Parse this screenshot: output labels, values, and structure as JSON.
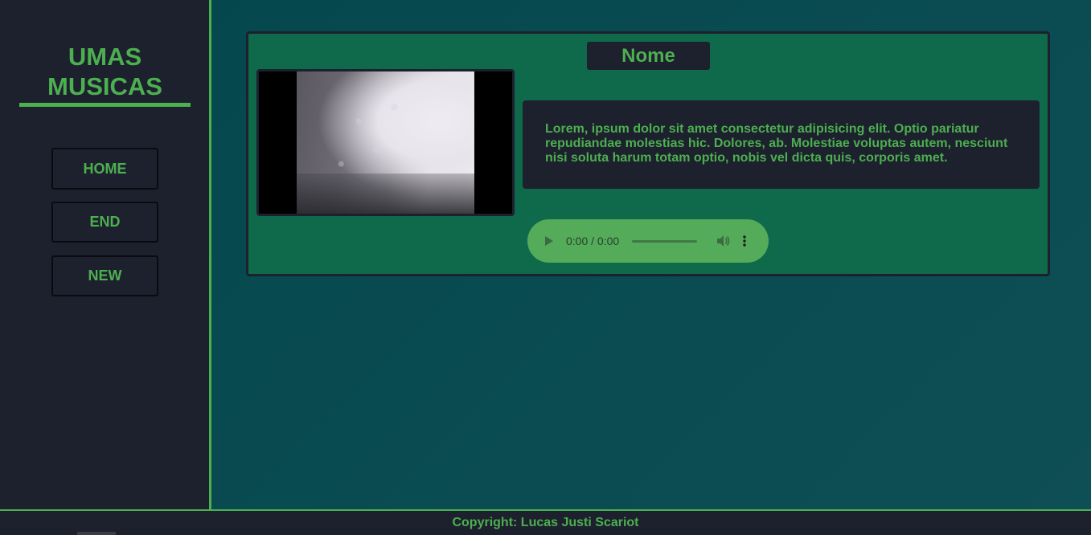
{
  "sidebar": {
    "logo_line1": "UMAS",
    "logo_line2": "MUSICAS",
    "nav": [
      {
        "label": "HOME"
      },
      {
        "label": "END"
      },
      {
        "label": "NEW"
      }
    ]
  },
  "card": {
    "title": "Nome",
    "description": "Lorem, ipsum dolor sit amet consectetur adipisicing elit. Optio pariatur repudiandae molestias hic. Dolores, ab. Molestiae voluptas autem, nesciunt nisi soluta harum totam optio, nobis vel dicta quis, corporis amet.",
    "audio": {
      "time": "0:00 / 0:00"
    }
  },
  "footer": {
    "copyright": "Copyright: Lucas Justi Scariot"
  },
  "colors": {
    "accent": "#4caf50",
    "panel": "#1d202d",
    "card": "#0f6a4b",
    "background": "#03474c"
  }
}
